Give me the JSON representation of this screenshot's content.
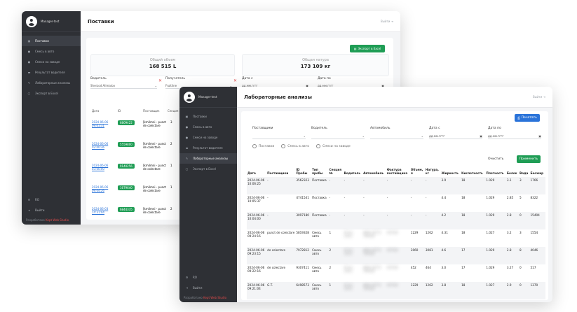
{
  "colors": {
    "sidebar": "#2e3035",
    "accent_green": "#1f9d55",
    "accent_blue": "#2a73d9",
    "danger": "#e04a4a"
  },
  "common": {
    "user_name": "Manager-test",
    "logout": "Выйти",
    "nav": [
      {
        "label": "Поставки",
        "icon": "truck-icon",
        "glyph": "▣"
      },
      {
        "label": "Смесь в авто",
        "icon": "circle-icon",
        "glyph": "●"
      },
      {
        "label": "Смеси на заводе",
        "icon": "circle-icon",
        "glyph": "●"
      },
      {
        "label": "Результат водителя",
        "icon": "chart-icon",
        "glyph": "▬"
      },
      {
        "label": "Лабораторные анализы",
        "icon": "flask-icon",
        "glyph": "✎"
      },
      {
        "label": "Экспорт в Excel",
        "icon": "file-icon",
        "glyph": "▢"
      }
    ],
    "bottom_nav": [
      {
        "label": "RO",
        "icon": "gear-icon",
        "glyph": "⚙"
      },
      {
        "label": "Выйти",
        "icon": "exit-icon",
        "glyph": "⇥"
      }
    ],
    "developer_prefix": "Разработано ",
    "developer_link": "Kept Web Studio"
  },
  "back": {
    "title": "Поставки",
    "export_label": "Экспорт в Excel",
    "stat1_label": "Общий объем",
    "stat1_value": "168 515 L",
    "stat2_label": "Общая натура",
    "stat2_value": "173 109 кг",
    "filters": {
      "driver_label": "Водитель",
      "driver_value": "Sherzod Alimatov",
      "receiver_label": "Получатель",
      "receiver_value": "Fruitline",
      "date_from_label": "Дата с",
      "date_from_ph": "дд.мм.гггг",
      "date_to_label": "Дата по",
      "date_to_ph": "дд.мм.гггг"
    },
    "headers": [
      "Дата",
      "ID",
      "Поставщик",
      "Секция №"
    ],
    "rows": [
      {
        "date": "2024-06-06 09:01:31",
        "id": "6809422",
        "supplier": "[kmilmni - punct de colectare",
        "section": "3"
      },
      {
        "date": "2024-06-06 02:00:36",
        "id": "5559800",
        "supplier": "[kmilmni - punct de colectare",
        "section": "2"
      },
      {
        "date": "2024-06-06 03:00:00",
        "id": "9140256",
        "supplier": "[kmilmni - punct de colectare",
        "section": "1"
      },
      {
        "date": "2024-06-06 09:04:26",
        "id": "1679640",
        "supplier": "[kmilmni - punct de colectare",
        "section": "1"
      },
      {
        "date": "2024-06-03 14:31:04",
        "id": "6844335",
        "supplier": "[kmilmni - punct de colectare",
        "section": "2"
      }
    ]
  },
  "front": {
    "title": "Лабораторные анализы",
    "print_label": "Печатать",
    "filters": {
      "suppliers_label": "Поставщики",
      "driver_label": "Водитель",
      "car_label": "Автомобиль",
      "date_from_label": "Дата с",
      "date_from_ph": "дд.мм.гггг",
      "date_to_label": "Дата по",
      "date_to_ph": "дд.мм.гггг"
    },
    "radios": [
      "Поставки",
      "Смесь в авто",
      "Смеси на заводе"
    ],
    "clear_label": "Очистить",
    "apply_label": "Применить",
    "headers": [
      "Дата",
      "Поставщики",
      "ID Пробы",
      "Тип пробы",
      "Секция №",
      "Водитель",
      "Автомобиль",
      "Фактура поставщика",
      "Объем, л",
      "Натура, кг",
      "Жирность",
      "Кислотность",
      "Плотность",
      "Белок",
      "Вода",
      "Бесжир"
    ],
    "rows": [
      [
        "2024-06-06 10:06:25",
        "-",
        "3562323",
        "Поставка",
        "-",
        "-",
        "-",
        "-",
        "-",
        "-",
        "3.9",
        "18",
        "1.029",
        "3.1",
        "3",
        "1766"
      ],
      [
        "2024-06-06 10:05:37",
        "-",
        "4741541",
        "Поставка",
        "-",
        "-",
        "-",
        "-",
        "-",
        "-",
        "4.4",
        "18",
        "1.029",
        "2.85",
        "5",
        "8322"
      ],
      [
        "2024-06-06 10:04:00",
        "-",
        "3097180",
        "Поставка",
        "-",
        "-",
        "-",
        "-",
        "-",
        "-",
        "4.2",
        "18",
        "1.029",
        "2.8",
        "0",
        "15404"
      ],
      [
        "2024-06-06 09:24:16",
        "punct de colectare",
        "5819328",
        "Смесь авто",
        "1",
        "Driver name",
        "BMW 30773 TRK506",
        "007500",
        "1229",
        "1262",
        "4.31",
        "18",
        "1.027",
        "3.2",
        "3",
        "1554"
      ],
      [
        "2024-06-06 09:23:15",
        "de colectare",
        "7972812",
        "Смесь авто",
        "2",
        "Driver name",
        "BMW 30773 TRK506",
        "007500",
        "3060",
        "3081",
        "4.6",
        "17",
        "1.029",
        "2.8",
        "8",
        "4046"
      ],
      [
        "2024-06-06 09:22:16",
        "de colectare",
        "9307411",
        "Смесь авто",
        "2",
        "Driver name",
        "BMW 30773 TRK506",
        "007500",
        "452",
        "464",
        "3.0",
        "17",
        "1.029",
        "3.27",
        "0",
        "517"
      ],
      [
        "2024-06-06 09:21:04",
        "G.T.",
        "6498573",
        "Смесь авто",
        "1",
        "Driver name",
        "BMW 30773 TRK506",
        "007500",
        "1229",
        "1262",
        "3.8",
        "18",
        "1.027",
        "2.9",
        "0",
        "1370"
      ]
    ],
    "blurred_cols": [
      1,
      5,
      6,
      7
    ]
  }
}
